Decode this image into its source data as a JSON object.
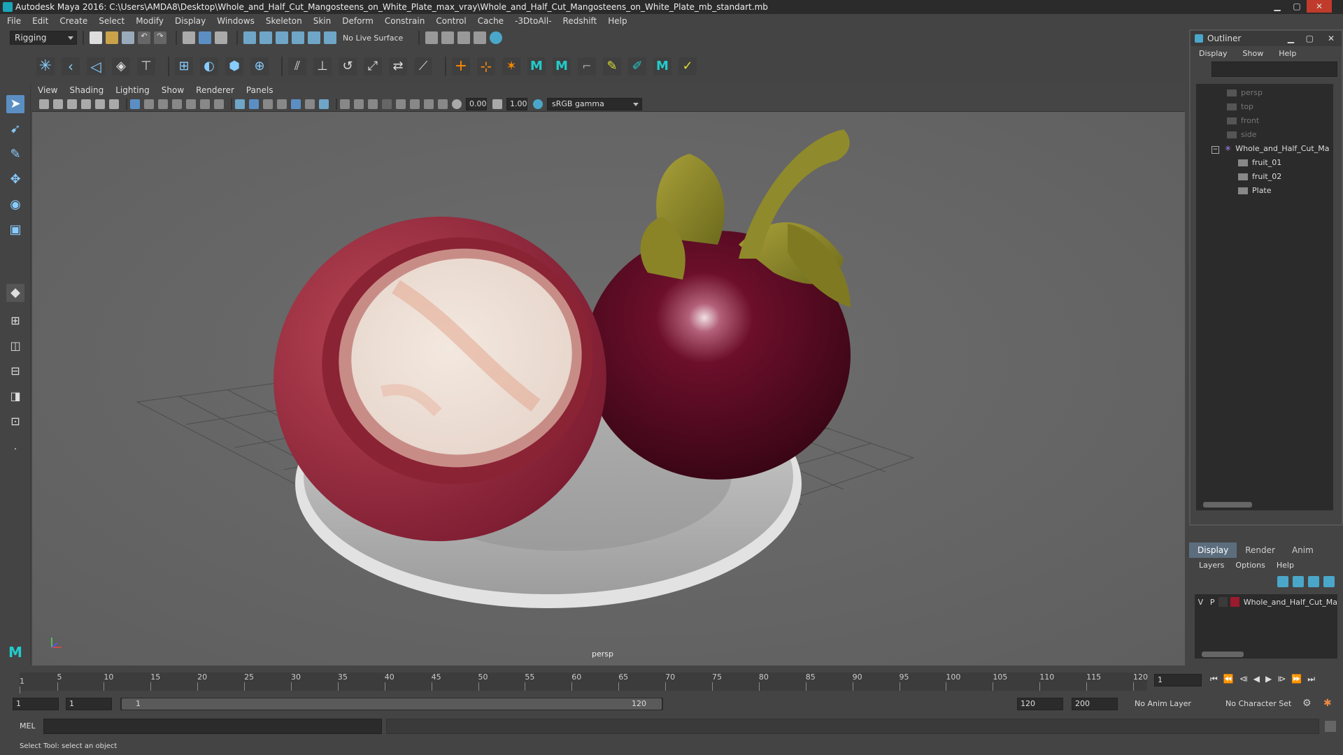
{
  "title": "Autodesk Maya 2016: C:\\Users\\AMDA8\\Desktop\\Whole_and_Half_Cut_Mangosteens_on_White_Plate_max_vray\\Whole_and_Half_Cut_Mangosteens_on_White_Plate_mb_standart.mb",
  "menubar": [
    "File",
    "Edit",
    "Create",
    "Select",
    "Modify",
    "Display",
    "Windows",
    "Skeleton",
    "Skin",
    "Deform",
    "Constrain",
    "Control",
    "Cache",
    "-3DtoAll-",
    "Redshift",
    "Help"
  ],
  "statusline": {
    "mode": "Rigging",
    "live_surface": "No Live Surface"
  },
  "viewport": {
    "menu": [
      "View",
      "Shading",
      "Lighting",
      "Show",
      "Renderer",
      "Panels"
    ],
    "exposure": "0.00",
    "gamma": "1.00",
    "color_space": "sRGB gamma",
    "camera_label": "persp"
  },
  "outliner": {
    "title": "Outliner",
    "menu": [
      "Display",
      "Show",
      "Help"
    ],
    "cameras": [
      "persp",
      "top",
      "front",
      "side"
    ],
    "group": "Whole_and_Half_Cut_Ma",
    "children": [
      "fruit_01",
      "fruit_02",
      "Plate"
    ]
  },
  "layers": {
    "tabs": [
      "Display",
      "Render",
      "Anim"
    ],
    "active_tab": "Display",
    "menu": [
      "Layers",
      "Options",
      "Help"
    ],
    "layer": {
      "v": "V",
      "p": "P",
      "name": "Whole_and_Half_Cut_Ma",
      "color": "#9b1a2e"
    }
  },
  "timeline": {
    "ticks": [
      "5",
      "10",
      "15",
      "20",
      "25",
      "30",
      "35",
      "40",
      "45",
      "50",
      "55",
      "60",
      "65",
      "70",
      "75",
      "80",
      "85",
      "90",
      "95",
      "100",
      "105",
      "110",
      "115",
      "120"
    ],
    "start_marker": "1",
    "current_frame": "1"
  },
  "range": {
    "start": "1",
    "playback_start": "1",
    "slider_start": "1",
    "slider_end": "120",
    "playback_end": "120",
    "end": "200",
    "anim_layer": "No Anim Layer",
    "character_set": "No Character Set"
  },
  "cmdline": {
    "label": "MEL"
  },
  "helpline": "Select Tool: select an object",
  "colors": {
    "accent": "#5c6e7e",
    "fruit_rind": "#7a1130",
    "flesh": "#eee6dc",
    "plate": "#c9c9c9"
  }
}
